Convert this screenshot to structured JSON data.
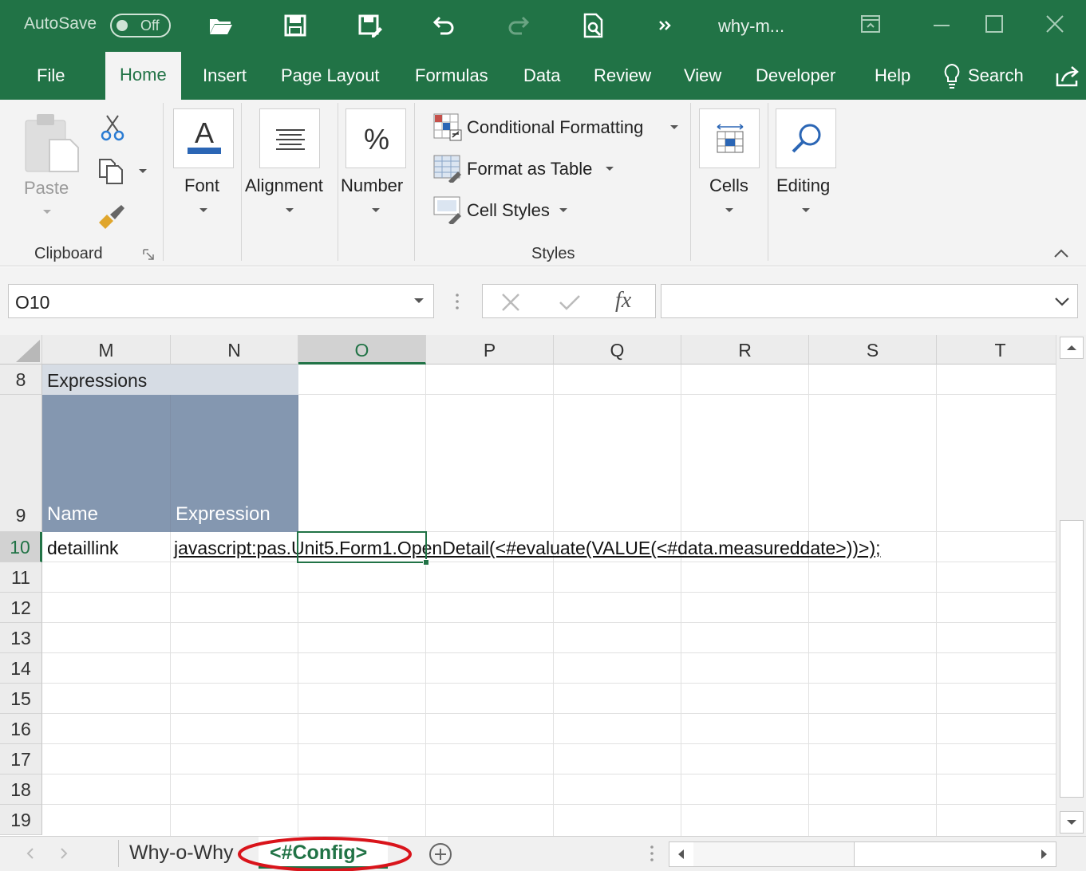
{
  "titlebar": {
    "autosave_label": "AutoSave",
    "autosave_state": "Off",
    "doc_title": "why-m..."
  },
  "tabs": [
    {
      "label": "File",
      "active": false
    },
    {
      "label": "Home",
      "active": true
    },
    {
      "label": "Insert",
      "active": false
    },
    {
      "label": "Page Layout",
      "active": false
    },
    {
      "label": "Formulas",
      "active": false
    },
    {
      "label": "Data",
      "active": false
    },
    {
      "label": "Review",
      "active": false
    },
    {
      "label": "View",
      "active": false
    },
    {
      "label": "Developer",
      "active": false
    },
    {
      "label": "Help",
      "active": false
    }
  ],
  "tellme": {
    "label": "Search"
  },
  "ribbon": {
    "clipboard": {
      "paste_label": "Paste",
      "group_label": "Clipboard"
    },
    "font": {
      "label": "Font"
    },
    "alignment": {
      "label": "Alignment"
    },
    "number": {
      "label": "Number"
    },
    "styles": {
      "conditional_formatting": "Conditional Formatting",
      "format_as_table": "Format as Table",
      "cell_styles": "Cell Styles",
      "group_label": "Styles"
    },
    "cells": {
      "label": "Cells"
    },
    "editing": {
      "label": "Editing"
    }
  },
  "formula_bar": {
    "name_box": "O10",
    "fx_label": "fx",
    "formula": ""
  },
  "grid": {
    "columns": [
      "M",
      "N",
      "O",
      "P",
      "Q",
      "R",
      "S",
      "T"
    ],
    "selected_column": "O",
    "rows": [
      "8",
      "9",
      "10",
      "11",
      "12",
      "13",
      "14",
      "15",
      "16",
      "17",
      "18",
      "19"
    ],
    "selected_row": "10",
    "cells": {
      "M8": "Expressions",
      "M9": "Name",
      "N9": "Expression",
      "M10": "detaillink",
      "N10": "javascript:pas.Unit5.Form1.OpenDetail(<#evaluate(VALUE(<#data.measureddate>))>);"
    }
  },
  "sheets": [
    {
      "label": "Why-o-Why",
      "active": false
    },
    {
      "label": "<#Config>",
      "active": true
    }
  ],
  "colors": {
    "brand_green": "#217346",
    "table_header": "#8497b0",
    "table_band": "#d6dce4",
    "highlight_ellipse": "#d9141b"
  }
}
